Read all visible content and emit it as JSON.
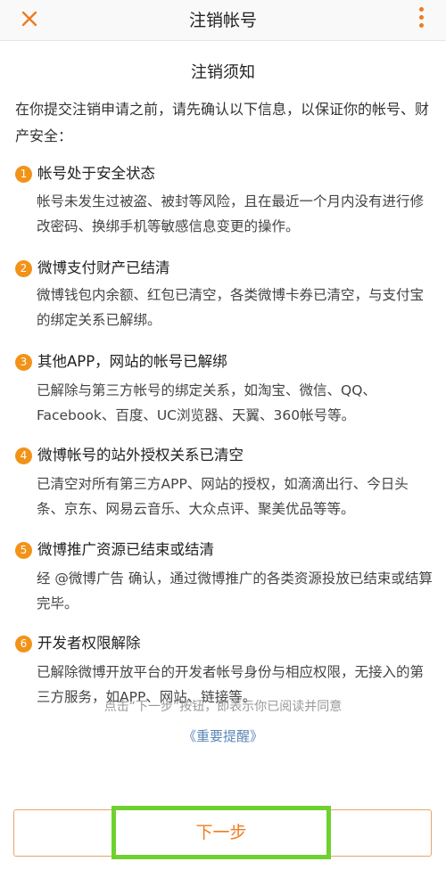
{
  "header": {
    "title": "注销帐号",
    "close_icon": "close-icon",
    "more_icon": "more-vertical-icon",
    "accent_color": "#f07b1e"
  },
  "notice": {
    "title": "注销须知",
    "intro": "在你提交注销申请之前，请先确认以下信息，以保证你的帐号、财产安全：",
    "items": [
      {
        "num": "1",
        "title": "帐号处于安全状态",
        "desc": "帐号未发生过被盗、被封等风险，且在最近一个月内没有进行修改密码、换绑手机等敏感信息变更的操作。"
      },
      {
        "num": "2",
        "title": "微博支付财产已结清",
        "desc": "微博钱包内余额、红包已清空，各类微博卡券已清空，与支付宝的绑定关系已解绑。"
      },
      {
        "num": "3",
        "title": "其他APP，网站的帐号已解绑",
        "desc": "已解除与第三方帐号的绑定关系，如淘宝、微信、QQ、Facebook、百度、UC浏览器、天翼、360帐号等。"
      },
      {
        "num": "4",
        "title": "微博帐号的站外授权关系已清空",
        "desc": "已清空对所有第三方APP、网站的授权，如滴滴出行、今日头条、京东、网易云音乐、大众点评、聚美优品等等。"
      },
      {
        "num": "5",
        "title": "微博推广资源已结束或结清",
        "desc": "经 @微博广告 确认，通过微博推广的各类资源投放已结束或结算完毕。"
      },
      {
        "num": "6",
        "title": "开发者权限解除",
        "desc": "已解除微博开放平台的开发者帐号身份与相应权限，无接入的第三方服务，如APP、网站、链接等。"
      }
    ]
  },
  "footer": {
    "note": "点击“下一步”按钮，即表示你已阅读并同意",
    "link": "《重要提醒》",
    "next_label": "下一步"
  }
}
